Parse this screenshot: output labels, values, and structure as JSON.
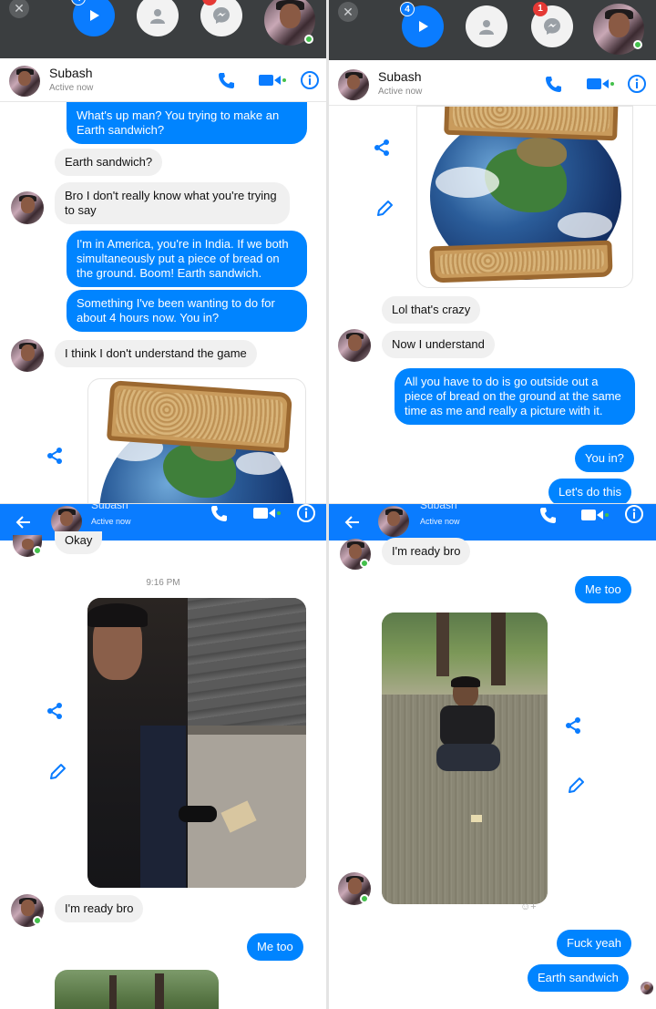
{
  "contact": {
    "name": "Subash",
    "status": "Active now",
    "header_name_cut": "Subash"
  },
  "chatheads": {
    "panel1_play_badge": "4",
    "panel1_messenger_badge": "1",
    "panel2_play_badge": "4",
    "panel2_messenger_badge": "1"
  },
  "panel1": {
    "messages": [
      {
        "from": "me",
        "text": "What's up man? You trying to make an Earth sandwich?"
      },
      {
        "from": "them",
        "text": "Earth sandwich?"
      },
      {
        "from": "them",
        "text": "Bro I don't really know what you're trying to say"
      },
      {
        "from": "me",
        "text": "I'm in America, you're in India. If we both simultaneously put a piece of bread on the ground. Boom! Earth sandwich."
      },
      {
        "from": "me",
        "text": "Something I've been wanting to do for about 4 hours now. You in?"
      },
      {
        "from": "them",
        "text": "I think I don't understand the game"
      }
    ]
  },
  "panel2": {
    "messages": [
      {
        "from": "them",
        "text": "Lol that's crazy"
      },
      {
        "from": "them",
        "text": "Now I understand"
      },
      {
        "from": "me",
        "text": "All you have to do is go outside out a piece of bread on the ground at the same time as me and really a picture with it."
      },
      {
        "from": "me",
        "text": "You in?"
      },
      {
        "from": "me",
        "text": "Let's do this"
      }
    ]
  },
  "panel3": {
    "messages": [
      {
        "from": "them",
        "text": "Okay"
      },
      {
        "from": "them",
        "text": "I'm ready bro"
      },
      {
        "from": "me",
        "text": "Me too"
      }
    ],
    "timestamp": "9:16 PM"
  },
  "panel4": {
    "messages": [
      {
        "from": "them",
        "text": "I'm ready bro"
      },
      {
        "from": "me",
        "text": "Me too"
      },
      {
        "from": "me",
        "text": "Fuck yeah"
      },
      {
        "from": "me",
        "text": "Earth sandwich"
      }
    ],
    "reaction_hint": "☺+"
  },
  "colors": {
    "messenger_blue": "#0084ff",
    "header_blue": "#0a7cff",
    "incoming_bubble": "#f0f0f0",
    "online_green": "#44c04c"
  },
  "icons": [
    "close-icon",
    "play-icon",
    "contacts-icon",
    "messenger-icon",
    "phone-icon",
    "video-icon",
    "info-icon",
    "share-icon",
    "pencil-icon",
    "back-arrow-icon"
  ]
}
